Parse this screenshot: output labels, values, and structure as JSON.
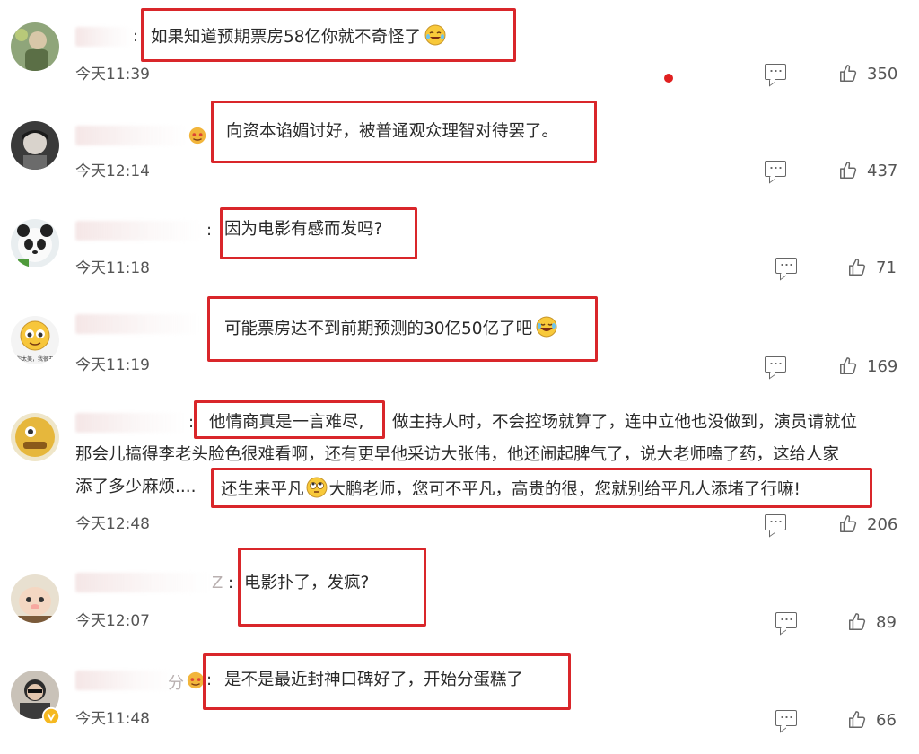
{
  "comments": [
    {
      "text": "如果知道预期票房58亿你就不奇怪了",
      "time": "今天11:39",
      "likes": "350"
    },
    {
      "text": "向资本谄媚讨好，被普通观众理智对待罢了。",
      "time": "今天12:14",
      "likes": "437"
    },
    {
      "text": "因为电影有感而发吗?",
      "time": "今天11:18",
      "likes": "71"
    },
    {
      "text": "可能票房达不到前期预测的30亿50亿了吧",
      "time": "今天11:19",
      "likes": "169"
    },
    {
      "text_hl": "他情商真是一言难尽,",
      "text_rest": "做主持人时，不会控场就算了，连中立他也没做到，演员请就位",
      "line2": "那会儿搞得李老头脸色很难看啊，还有更早他采访大张伟，他还闹起脾气了，说大老师嗑了药，这给人家",
      "line3_a": "添了多少麻烦....",
      "line3_b": "还生来平凡",
      "line3_c": "大鹏老师，您可不平凡，高贵的很，您就别给平凡人添堵了行嘛!",
      "time": "今天12:48",
      "likes": "206"
    },
    {
      "text": "电影扑了，发疯?",
      "time": "今天12:07",
      "likes": "89"
    },
    {
      "text": "是不是最近封神口碑好了，开始分蛋糕了",
      "time": "今天11:48",
      "likes": "66"
    }
  ],
  "avatar_caption": "你太美，我很丑",
  "name_fragments": [
    "Z",
    "分"
  ],
  "icons": {
    "reply": "comment-icon",
    "like": "thumbs-up-icon"
  },
  "colors": {
    "highlight": "#d9262a",
    "text": "#2a2a2a",
    "meta": "#555555"
  }
}
